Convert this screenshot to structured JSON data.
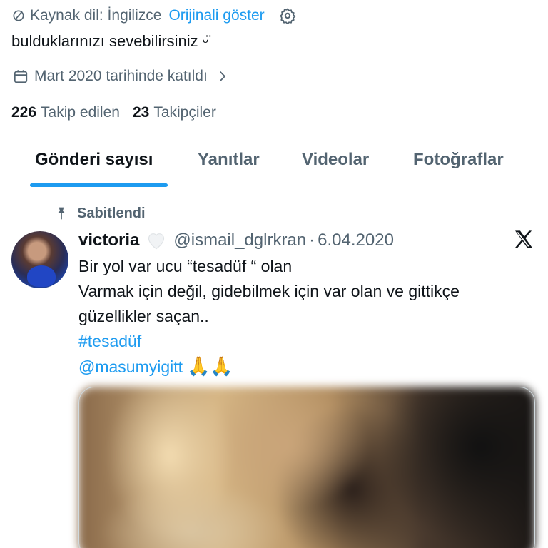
{
  "translation": {
    "source_label": "Kaynak dil: İngilizce",
    "show_original": "Orijinali göster",
    "globe_icon": "globe-slash-icon",
    "settings_icon": "gear-icon"
  },
  "profile": {
    "bio": "bulduklarınızı sevebilirsiniz ᵕ̈",
    "joined": "Mart 2020 tarihinde katıldı",
    "following_count": "226",
    "following_label": "Takip edilen",
    "followers_count": "23",
    "followers_label": "Takipçiler"
  },
  "tabs": [
    {
      "label": "Gönderi sayısı",
      "active": true
    },
    {
      "label": "Yanıtlar",
      "active": false
    },
    {
      "label": "Videolar",
      "active": false
    },
    {
      "label": "Fotoğraflar",
      "active": false
    }
  ],
  "tweet": {
    "pinned_label": "Sabitlendi",
    "author_name": "victoria",
    "handle": "@ismail_dglrkran",
    "separator": "·",
    "date": "6.04.2020",
    "lines": [
      "Bir yol var ucu “tesadüf “ olan",
      "Varmak için değil, gidebilmek için var olan ve gittikçe",
      "güzellikler saçan.."
    ],
    "hashtag": "#tesadüf",
    "mention": "@masumyigitt",
    "emoji": "🙏🙏",
    "colors": {
      "accent": "#1d9bf0",
      "muted": "#536471",
      "text": "#0f1419"
    }
  }
}
